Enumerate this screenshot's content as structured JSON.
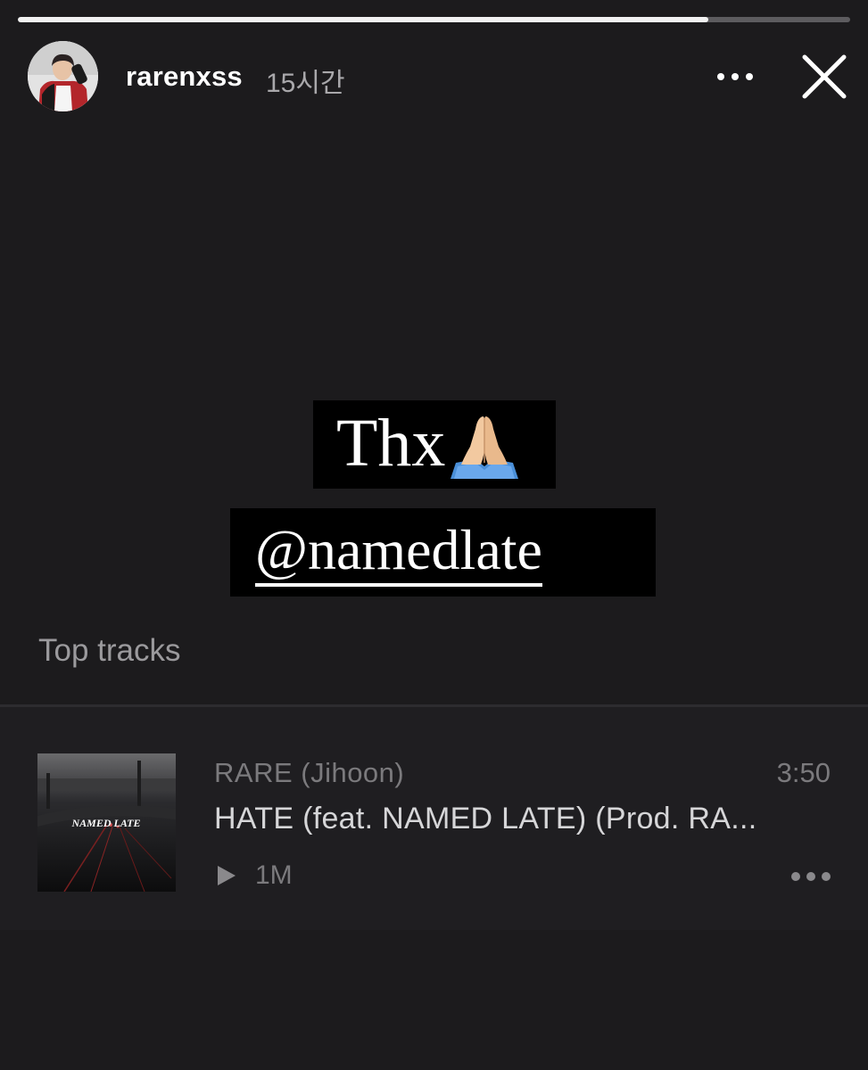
{
  "story": {
    "username": "rarenxss",
    "timestamp": "15시간",
    "progress": 0.83
  },
  "stickers": {
    "thx_text": "Thx",
    "thx_emoji": "folded-hands-emoji",
    "mention": "@namedlate"
  },
  "music": {
    "section_title": "Top tracks",
    "track": {
      "artist": "RARE (Jihoon)",
      "duration": "3:50",
      "title": "HATE (feat. NAMED LATE) (Prod. RA...",
      "plays": "1M",
      "album_art_text": "NAMED LATE"
    }
  },
  "icons": {
    "more": "more-horizontal-icon",
    "close": "close-icon",
    "play": "play-icon"
  },
  "colors": {
    "background": "#1c1b1d",
    "progress_fill": "#f2f2f2",
    "progress_track": "#5d5c5f",
    "secondary_text": "#7b7a7d"
  }
}
